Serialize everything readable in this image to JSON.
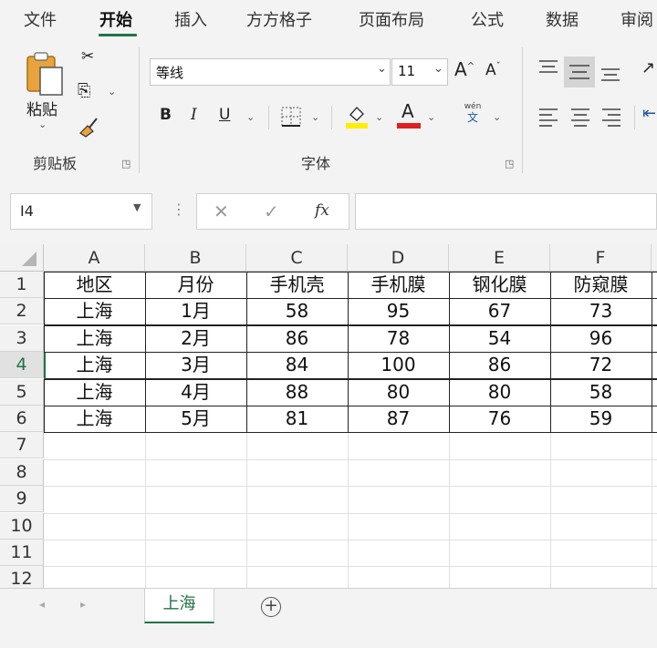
{
  "ribbon_tabs": [
    "文件",
    "开始",
    "插入",
    "方方格子",
    "页面布局",
    "公式",
    "数据",
    "审阅"
  ],
  "clipboard": {
    "paste_label": "粘贴",
    "group_label": "剪贴板"
  },
  "font": {
    "name": "等线",
    "size": "11",
    "group_label": "字体",
    "bold": "B",
    "italic": "I",
    "underline": "U",
    "phonetic_top": "wén",
    "phonetic_bottom": "文",
    "grow": "A",
    "shrink": "A",
    "font_color_letter": "A"
  },
  "colors": {
    "accent": "#217346",
    "highlight": "#ffee00",
    "font_color": "#e02020"
  },
  "name_box": "I4",
  "formula_bar": {
    "fx": "fx",
    "cancel": "✕",
    "enter": "✓",
    "value": ""
  },
  "columns": [
    "A",
    "B",
    "C",
    "D",
    "E",
    "F"
  ],
  "rows": [
    "1",
    "2",
    "3",
    "4",
    "5",
    "6",
    "7",
    "8",
    "9",
    "10",
    "11",
    "12"
  ],
  "table": {
    "headers": [
      "地区",
      "月份",
      "手机壳",
      "手机膜",
      "钢化膜",
      "防窥膜"
    ],
    "data": [
      [
        "上海",
        "1月",
        "58",
        "95",
        "67",
        "73"
      ],
      [
        "上海",
        "2月",
        "86",
        "78",
        "54",
        "96"
      ],
      [
        "上海",
        "3月",
        "84",
        "100",
        "86",
        "72"
      ],
      [
        "上海",
        "4月",
        "88",
        "80",
        "80",
        "58"
      ],
      [
        "上海",
        "5月",
        "81",
        "87",
        "76",
        "59"
      ]
    ]
  },
  "sheet_tab": "上海",
  "add_sheet": "+"
}
